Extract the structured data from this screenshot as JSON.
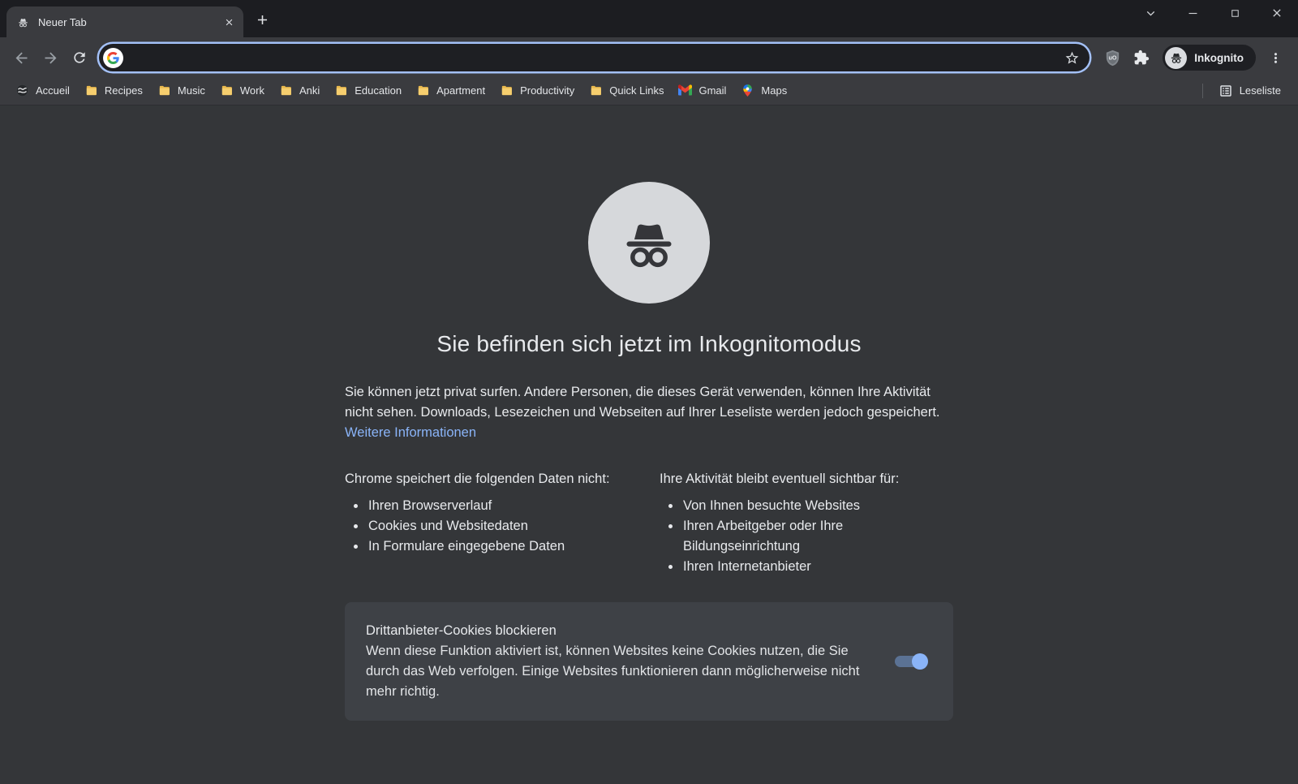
{
  "window": {
    "tab_title": "Neuer Tab"
  },
  "toolbar": {
    "url_value": "",
    "incognito_badge_label": "Inkognito",
    "icons": {
      "back": "arrow-back",
      "forward": "arrow-forward",
      "reload": "refresh",
      "bookmark_star": "star-outline",
      "ublock": "ublock-shield",
      "extensions": "puzzle-piece",
      "menu": "three-dot-menu"
    }
  },
  "bookmarks": {
    "items": [
      {
        "label": "Accueil",
        "icon": "globe-favicon"
      },
      {
        "label": "Recipes",
        "icon": "folder"
      },
      {
        "label": "Music",
        "icon": "folder"
      },
      {
        "label": "Work",
        "icon": "folder"
      },
      {
        "label": "Anki",
        "icon": "folder"
      },
      {
        "label": "Education",
        "icon": "folder"
      },
      {
        "label": "Apartment",
        "icon": "folder"
      },
      {
        "label": "Productivity",
        "icon": "folder"
      },
      {
        "label": "Quick Links",
        "icon": "folder"
      },
      {
        "label": "Gmail",
        "icon": "gmail"
      },
      {
        "label": "Maps",
        "icon": "google-maps-pin"
      }
    ],
    "reading_list_label": "Leseliste"
  },
  "page": {
    "title": "Sie befinden sich jetzt im Inkognitomodus",
    "intro_text": "Sie können jetzt privat surfen. Andere Personen, die dieses Gerät verwenden, können Ihre Aktivität nicht sehen. Downloads, Lesezeichen und Webseiten auf Ihrer Leseliste werden jedoch gespeichert. ",
    "intro_link": "Weitere Informationen",
    "columns": [
      {
        "heading": "Chrome speichert die folgenden Daten nicht:",
        "items": [
          "Ihren Browserverlauf",
          "Cookies und Websitedaten",
          "In Formulare eingegebene Daten"
        ]
      },
      {
        "heading": "Ihre Aktivität bleibt eventuell sichtbar für:",
        "items": [
          "Von Ihnen besuchte Websites",
          "Ihren Arbeitgeber oder Ihre Bildungseinrichtung",
          "Ihren Internetanbieter"
        ]
      }
    ],
    "cookie_card": {
      "title": "Drittanbieter-Cookies blockieren",
      "description": "Wenn diese Funktion aktiviert ist, können Websites keine Cookies nutzen, die Sie durch das Web verfolgen. Einige Websites funktionieren dann möglicherweise nicht mehr richtig.",
      "toggle_on": true
    }
  },
  "colors": {
    "accent_link": "#8AB4F8",
    "toggle_on": "#8AB4F8",
    "focus_ring": "#A3C0F7",
    "toolbar_bg": "#3A3B3F",
    "page_bg": "#343639",
    "card_bg": "#3E4146",
    "frame_bg": "#1C1D21"
  }
}
